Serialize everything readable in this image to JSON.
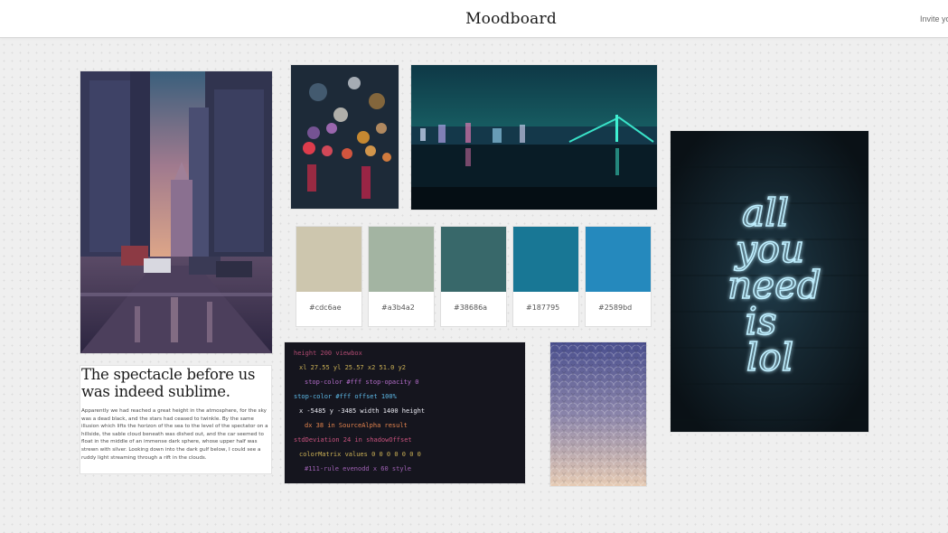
{
  "header": {
    "title": "Moodboard",
    "invite_label": "Invite yo"
  },
  "images": [
    {
      "name": "city-street-image",
      "subject": "rainy city street at dusk"
    },
    {
      "name": "bokeh-lights-image",
      "subject": "bokeh city lights"
    },
    {
      "name": "night-bridge-image",
      "subject": "neon bridge skyline at night"
    },
    {
      "name": "neon-sign-image",
      "subject": "neon sign on brick wall"
    },
    {
      "name": "code-screen-image",
      "subject": "code on screen"
    },
    {
      "name": "scallop-pattern-image",
      "subject": "scallop gradient pattern"
    }
  ],
  "neon_sign": {
    "lines": [
      "all",
      "you",
      "need",
      "is",
      "lol"
    ]
  },
  "palette": [
    {
      "hex": "#cdc6ae",
      "label": "#cdc6ae"
    },
    {
      "hex": "#a3b4a2",
      "label": "#a3b4a2"
    },
    {
      "hex": "#38686a",
      "label": "#38686a"
    },
    {
      "hex": "#187795",
      "label": "#187795"
    },
    {
      "hex": "#2589bd",
      "label": "#2589bd"
    }
  ],
  "text_card": {
    "heading": "The spectacle before us was indeed sublime.",
    "body": "Apparently we had reached a great height in the atmosphere, for the sky was a dead black, and the stars had ceased to twinkle. By the same illusion which lifts the horizon of the sea to the level of the spectator on a hillside, the sable cloud beneath was dished out, and the car seemed to float in the middle of an immense dark sphere, whose upper half was strewn with silver. Looking down into the dark gulf below, I could see a ruddy light streaming through a rift in the clouds."
  },
  "code_card": {
    "lines": [
      "height  200  viewbox",
      "xl 27.55   yl 25.57  x2 51.0  y2",
      "stop-color  #fff  stop-opacity  0",
      "stop-color  #fff  offset  100%",
      "x  -5485  y  -3485  width  1400  height",
      "dx  38  in  SourceAlpha  result",
      "stdDeviation  24  in  shadowOffset",
      "colorMatrix  values  0 0 0 0 0 0 0",
      "#111-rule  evenodd  x  60  style"
    ]
  }
}
